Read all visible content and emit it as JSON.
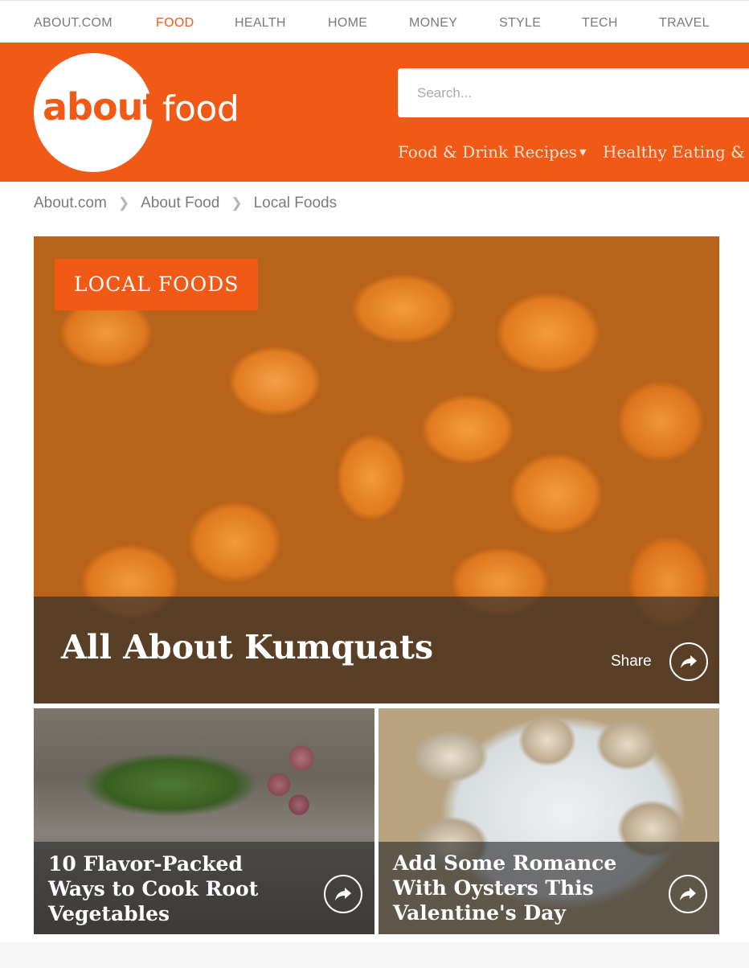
{
  "topnav": {
    "items": [
      {
        "label": "ABOUT.COM"
      },
      {
        "label": "FOOD"
      },
      {
        "label": "HEALTH"
      },
      {
        "label": "HOME"
      },
      {
        "label": "MONEY"
      },
      {
        "label": "STYLE"
      },
      {
        "label": "TECH"
      },
      {
        "label": "TRAVEL"
      }
    ],
    "active": "FOOD"
  },
  "header": {
    "logo_about": "about",
    "logo_food": "food",
    "search_placeholder": "Search...",
    "categories": [
      {
        "label": "Food & Drink Recipes"
      },
      {
        "label": "Healthy Eating & "
      }
    ]
  },
  "breadcrumb": {
    "items": [
      {
        "label": "About.com"
      },
      {
        "label": "About Food"
      },
      {
        "label": "Local Foods"
      }
    ]
  },
  "hero": {
    "badge": "LOCAL FOODS",
    "title": "All About Kumquats",
    "share_label": "Share"
  },
  "cards": [
    {
      "title": "10 Flavor-Packed Ways to Cook Root Vegetables"
    },
    {
      "title": "Add Some Romance With Oysters This Valentine's Day"
    }
  ],
  "colors": {
    "brand_orange": "#f15a16",
    "nav_gray": "#7a7a7a"
  },
  "icons": {
    "share": "share-arrow-icon",
    "caret": "chevron-down-icon",
    "separator": "chevron-right-icon"
  }
}
